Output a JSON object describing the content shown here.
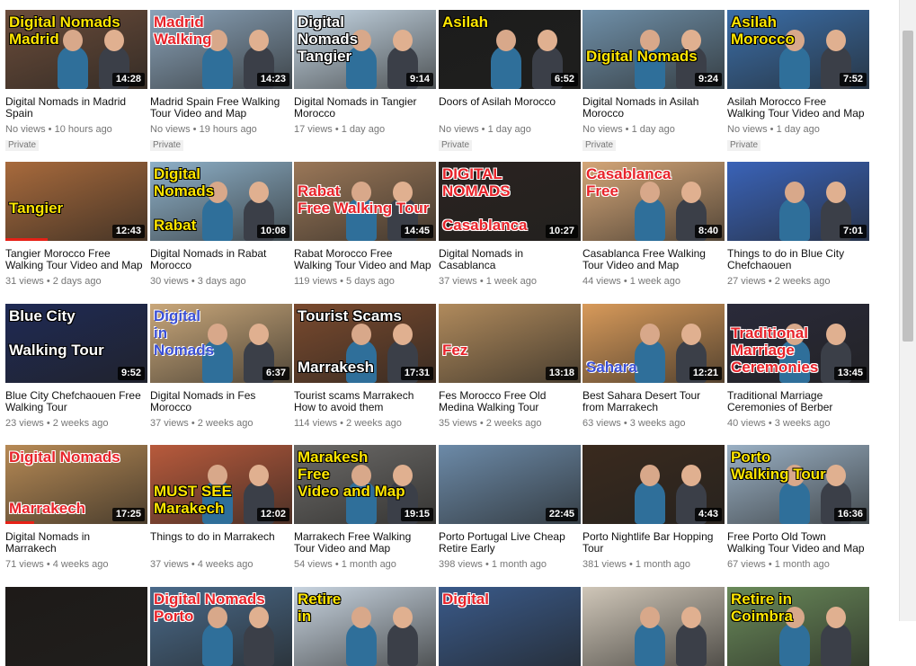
{
  "videos": [
    {
      "title": "Digital Nomads in Madrid Spain",
      "meta": "No views • 10 hours ago",
      "badge": "Private",
      "duration": "14:28",
      "overlay": "Digital Nomads\nMadrid",
      "style": "yellow",
      "bg": "#6b4c3a"
    },
    {
      "title": "Madrid Spain Free Walking Tour Video and Map",
      "meta": "No views • 19 hours ago",
      "badge": "Private",
      "duration": "14:23",
      "overlay": "Madrid\nWalking",
      "style": "red",
      "bg": "#8aa2b8"
    },
    {
      "title": "Digital Nomads in Tangier Morocco",
      "meta": "17 views • 1 day ago",
      "badge": "",
      "duration": "9:14",
      "overlay": "Digital\nNomads\nTangier",
      "style": "white",
      "bg": "#c7d8e6"
    },
    {
      "title": "Doors of Asilah Morocco",
      "meta": "No views • 1 day ago",
      "badge": "Private",
      "duration": "6:52",
      "overlay": "Asilah",
      "style": "yellow",
      "bg": "#1c1c1c"
    },
    {
      "title": "Digital Nomads in Asilah Morocco",
      "meta": "No views • 1 day ago",
      "badge": "Private",
      "duration": "9:24",
      "overlay": "\n\nDigital Nomads",
      "style": "yellow",
      "bg": "#6f8fa8"
    },
    {
      "title": "Asilah Morocco Free Walking Tour Video and Map",
      "meta": "No views • 1 day ago",
      "badge": "Private",
      "duration": "7:52",
      "overlay": "Asilah\nMorocco",
      "style": "yellow",
      "bg": "#3b6ea8"
    },
    {
      "title": "Tangier Morocco Free Walking Tour Video and Map",
      "meta": "31 views • 2 days ago",
      "badge": "",
      "duration": "12:43",
      "overlay": "\n\nTangier",
      "style": "yellow",
      "bg": "#a86a3c",
      "progress": 0.3
    },
    {
      "title": "Digital Nomads in Rabat Morocco",
      "meta": "30 views • 3 days ago",
      "badge": "",
      "duration": "10:08",
      "overlay": "Digital\nNomads\n\nRabat",
      "style": "yellow",
      "bg": "#8eb0c8"
    },
    {
      "title": "Rabat Morocco Free Walking Tour Video and Map",
      "meta": "119 views • 5 days ago",
      "badge": "",
      "duration": "14:45",
      "overlay": "\nRabat\nFree Walking Tour",
      "style": "red",
      "bg": "#9a7758"
    },
    {
      "title": "Digital Nomads in Casablanca",
      "meta": "37 views • 1 week ago",
      "badge": "",
      "duration": "10:27",
      "overlay": "DIGITAL\nNOMADS\n\nCasablanca",
      "style": "red",
      "bg": "#2a2320"
    },
    {
      "title": "Casablanca Free Walking Tour Video and Map",
      "meta": "44 views • 1 week ago",
      "badge": "",
      "duration": "8:40",
      "overlay": "Casablanca\nFree",
      "style": "red",
      "bg": "#d4a678"
    },
    {
      "title": "Things to do in Blue City Chefchaouen",
      "meta": "27 views • 2 weeks ago",
      "badge": "",
      "duration": "7:01",
      "overlay": "",
      "style": "white",
      "bg": "#3a63b8"
    },
    {
      "title": "Blue City Chefchaouen Free Walking Tour",
      "meta": "23 views • 2 weeks ago",
      "badge": "",
      "duration": "9:52",
      "overlay": "Blue City\n\nWalking Tour",
      "style": "white",
      "bg": "#1f2a55"
    },
    {
      "title": "Digital Nomads in Fes Morocco",
      "meta": "37 views • 2 weeks ago",
      "badge": "",
      "duration": "6:37",
      "overlay": "Digital\nin\nNomads",
      "style": "blue",
      "bg": "#c9a77a"
    },
    {
      "title": "Tourist scams Marrakech How to avoid them",
      "meta": "114 views • 2 weeks ago",
      "badge": "",
      "duration": "17:31",
      "overlay": "Tourist Scams\n\n\nMarrakesh",
      "style": "white",
      "bg": "#7a4a2e"
    },
    {
      "title": "Fes Morocco Free Old Medina Walking Tour",
      "meta": "35 views • 2 weeks ago",
      "badge": "",
      "duration": "13:18",
      "overlay": "\n\nFez",
      "style": "red",
      "bg": "#b08a5c"
    },
    {
      "title": "Best Sahara Desert Tour from Marrakech",
      "meta": "63 views • 3 weeks ago",
      "badge": "",
      "duration": "12:21",
      "overlay": "\n\n\nSahara",
      "style": "blue",
      "bg": "#d89a5a"
    },
    {
      "title": "Traditional Marriage Ceremonies of Berber People...",
      "meta": "40 views • 3 weeks ago",
      "badge": "",
      "duration": "13:45",
      "overlay": "\nTraditional\nMarriage\nCeremonies",
      "style": "red",
      "bg": "#2a2a3a"
    },
    {
      "title": "Digital Nomads in Marrakech",
      "meta": "71 views • 4 weeks ago",
      "badge": "",
      "duration": "17:25",
      "overlay": "Digital Nomads\n\n\nMarrakech",
      "style": "red",
      "bg": "#b78a55",
      "progress": 0.2
    },
    {
      "title": "Things to do in Marrakech",
      "meta": "37 views • 4 weeks ago",
      "badge": "",
      "duration": "12:02",
      "overlay": "\n\nMUST SEE\nMarakech",
      "style": "yellow",
      "bg": "#b85a3c"
    },
    {
      "title": "Marrakech Free Walking Tour Video and Map",
      "meta": "54 views • 1 month ago",
      "badge": "",
      "duration": "19:15",
      "overlay": "Marakesh\nFree\nVideo and Map",
      "style": "yellow",
      "bg": "#6c6a68"
    },
    {
      "title": "Porto Portugal Live Cheap Retire Early",
      "meta": "398 views • 1 month ago",
      "badge": "",
      "duration": "22:45",
      "overlay": "",
      "style": "white",
      "bg": "#6c8aa8"
    },
    {
      "title": "Porto Nightlife Bar Hopping Tour",
      "meta": "381 views • 1 month ago",
      "badge": "",
      "duration": "4:43",
      "overlay": "",
      "style": "white",
      "bg": "#3a2a1e"
    },
    {
      "title": "Free Porto Old Town Walking Tour Video and Map",
      "meta": "67 views • 1 month ago",
      "badge": "",
      "duration": "16:36",
      "overlay": "Porto\nWalking Tour",
      "style": "yellow",
      "bg": "#9ab0c4"
    },
    {
      "title": "",
      "meta": "",
      "badge": "",
      "duration": "",
      "overlay": "",
      "style": "white",
      "bg": "#1e1a18"
    },
    {
      "title": "",
      "meta": "",
      "badge": "",
      "duration": "",
      "overlay": "Digital Nomads\nPorto",
      "style": "red",
      "bg": "#4a6a8a"
    },
    {
      "title": "",
      "meta": "",
      "badge": "",
      "duration": "",
      "overlay": "Retire\nin",
      "style": "yellow",
      "bg": "#c8d4e0"
    },
    {
      "title": "",
      "meta": "",
      "badge": "",
      "duration": "",
      "overlay": "Digital",
      "style": "red",
      "bg": "#3a5a8a"
    },
    {
      "title": "",
      "meta": "",
      "badge": "",
      "duration": "",
      "overlay": "",
      "style": "white",
      "bg": "#cfc6b8"
    },
    {
      "title": "",
      "meta": "",
      "badge": "",
      "duration": "",
      "overlay": "Retire in\nCoimbra",
      "style": "yellow",
      "bg": "#6a8a5a"
    }
  ]
}
